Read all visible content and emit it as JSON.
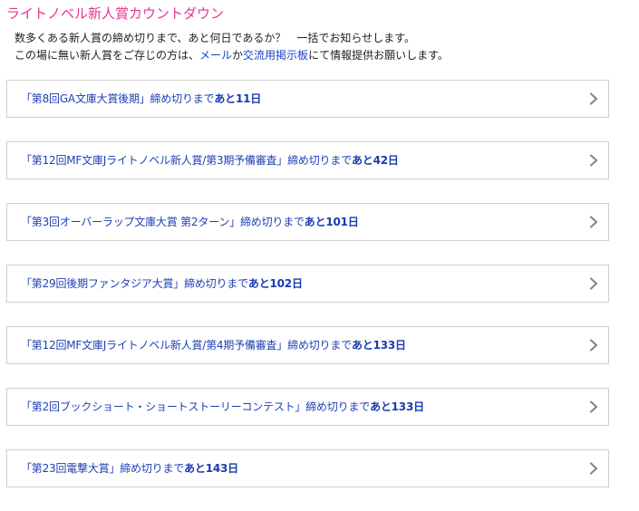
{
  "header": {
    "title": "ライトノベル新人賞カウントダウン"
  },
  "intro": {
    "line1": "数多くある新人賞の締め切りまで、あと何日であるか？　一括でお知らせします。",
    "line2_pre": "この場に無い新人賞をご存じの方は、",
    "mail_link": "メール",
    "line2_mid": "か",
    "board_link": "交流用掲示板",
    "line2_post": "にて情報提供お願いします。"
  },
  "countdowns": [
    {
      "award": "「第8回GA文庫大賞後期」",
      "suffix": "締め切りまで",
      "remaining": "あと11日"
    },
    {
      "award": "「第12回MF文庫Jライトノベル新人賞/第3期予備審査」",
      "suffix": "締め切りまで",
      "remaining": "あと42日"
    },
    {
      "award": "「第3回オーバーラップ文庫大賞 第2ターン」",
      "suffix": "締め切りまで",
      "remaining": "あと101日"
    },
    {
      "award": "「第29回後期ファンタジア大賞」",
      "suffix": "締め切りまで",
      "remaining": "あと102日"
    },
    {
      "award": "「第12回MF文庫Jライトノベル新人賞/第4期予備審査」",
      "suffix": "締め切りまで",
      "remaining": "あと133日"
    },
    {
      "award": "「第2回ブックショート・ショートストーリーコンテスト」",
      "suffix": "締め切りまで",
      "remaining": "あと133日"
    },
    {
      "award": "「第23回電撃大賞」",
      "suffix": "締め切りまで",
      "remaining": "あと143日"
    }
  ],
  "icons": {
    "chevron": "chevron-right-icon"
  },
  "colors": {
    "title": "#e8358e",
    "link": "#1f3fb5",
    "border": "#cfcfcf",
    "chevron": "#888888"
  }
}
